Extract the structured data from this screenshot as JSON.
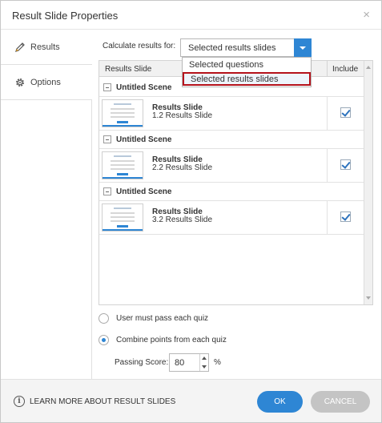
{
  "dialog": {
    "title": "Result Slide Properties",
    "close_glyph": "×"
  },
  "sidebar": {
    "items": [
      {
        "label": "Results",
        "icon": "pencil-icon"
      },
      {
        "label": "Options",
        "icon": "gear-icon"
      }
    ]
  },
  "calc": {
    "label": "Calculate results for:",
    "selected": "Selected results slides",
    "options": [
      "Selected questions",
      "Selected results slides"
    ]
  },
  "grid": {
    "col_name": "Results Slide",
    "col_include": "Include",
    "scenes": [
      {
        "name": "Untitled Scene",
        "slide_title": "Results Slide",
        "slide_sub": "1.2 Results Slide",
        "included": true
      },
      {
        "name": "Untitled Scene",
        "slide_title": "Results Slide",
        "slide_sub": "2.2 Results Slide",
        "included": true
      },
      {
        "name": "Untitled Scene",
        "slide_title": "Results Slide",
        "slide_sub": "3.2 Results Slide",
        "included": true
      }
    ]
  },
  "options": {
    "radio_pass_each": "User must pass each quiz",
    "radio_combine": "Combine points from each quiz",
    "selected": "combine",
    "passing_label": "Passing Score:",
    "passing_value": "80",
    "passing_unit": "%"
  },
  "footer": {
    "info_glyph": "i",
    "learn_more": "LEARN MORE ABOUT RESULT SLIDES",
    "ok": "OK",
    "cancel": "CANCEL"
  },
  "colors": {
    "accent": "#2e86d4",
    "highlight_border": "#b5121b",
    "cancel_bg": "#c4c4c4"
  }
}
